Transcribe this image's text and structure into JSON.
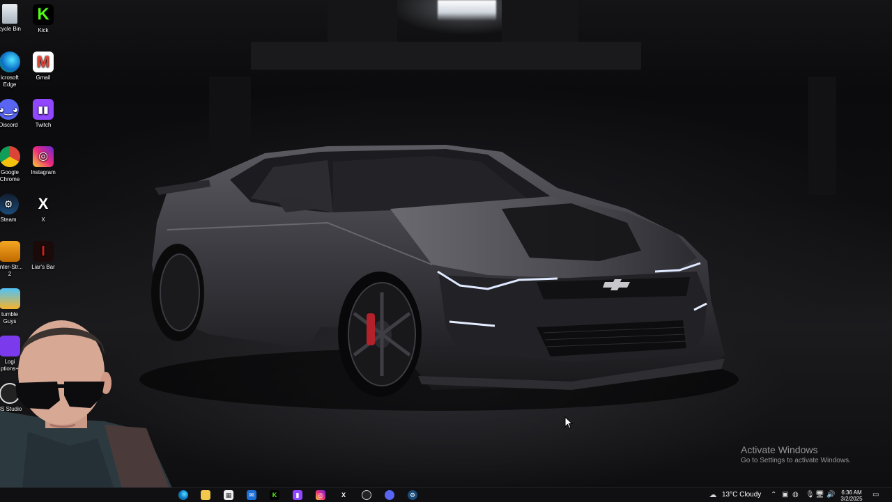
{
  "desktop": {
    "icons": [
      {
        "id": "recycle-bin",
        "label": "cycle Bin"
      },
      {
        "id": "kick",
        "label": "Kick"
      },
      {
        "id": "edge",
        "label": "icrosoft Edge"
      },
      {
        "id": "gmail",
        "label": "Gmail"
      },
      {
        "id": "discord",
        "label": "Discord"
      },
      {
        "id": "twitch",
        "label": "Twitch"
      },
      {
        "id": "chrome",
        "label": "Google Chrome"
      },
      {
        "id": "instagram",
        "label": "Instagram"
      },
      {
        "id": "steam",
        "label": "Steam"
      },
      {
        "id": "x",
        "label": "X"
      },
      {
        "id": "counter-strike",
        "label": "unter-Str... 2"
      },
      {
        "id": "liars-bar",
        "label": "Liar's Bar"
      },
      {
        "id": "stumble-guys",
        "label": "tumble Guys"
      },
      {
        "id": "logi-options",
        "label": "Logi ptions+"
      },
      {
        "id": "obs-studio",
        "label": "3S Studio"
      }
    ]
  },
  "watermark": {
    "title": "Activate Windows",
    "subtitle": "Go to Settings to activate Windows."
  },
  "taskbar": {
    "pinned": [
      "edge-icon",
      "file-explorer-icon",
      "microsoft-store-icon",
      "mail-icon",
      "kick-icon",
      "twitch-icon",
      "instagram-icon",
      "x-icon",
      "obs-icon",
      "discord-icon",
      "steam-icon"
    ],
    "weather": "13°C  Cloudy",
    "time": "6:36 AM",
    "date": "3/2/2025"
  },
  "colors": {
    "kick": "#53fc18",
    "twitch": "#9146ff",
    "discord": "#5865f2",
    "taskbar": "#101012"
  }
}
